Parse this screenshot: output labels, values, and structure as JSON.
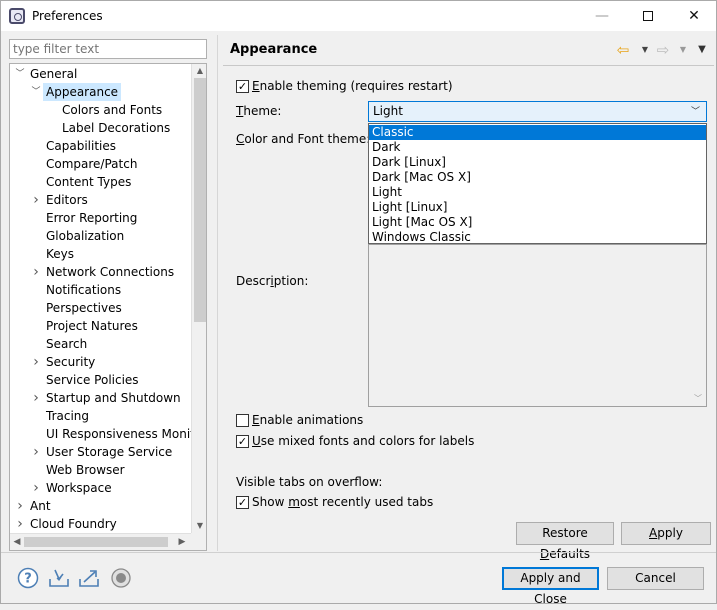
{
  "window": {
    "title": "Preferences",
    "controls": {
      "minimize": "—",
      "close": "✕"
    }
  },
  "filter": {
    "placeholder": "type filter text"
  },
  "tree": {
    "items": [
      {
        "label": "General",
        "level": 0,
        "toggle": "expanded"
      },
      {
        "label": "Appearance",
        "level": 1,
        "toggle": "expanded",
        "selected": true
      },
      {
        "label": "Colors and Fonts",
        "level": 2,
        "toggle": "none"
      },
      {
        "label": "Label Decorations",
        "level": 2,
        "toggle": "none"
      },
      {
        "label": "Capabilities",
        "level": 1,
        "toggle": "none"
      },
      {
        "label": "Compare/Patch",
        "level": 1,
        "toggle": "none"
      },
      {
        "label": "Content Types",
        "level": 1,
        "toggle": "none"
      },
      {
        "label": "Editors",
        "level": 1,
        "toggle": "collapsed"
      },
      {
        "label": "Error Reporting",
        "level": 1,
        "toggle": "none"
      },
      {
        "label": "Globalization",
        "level": 1,
        "toggle": "none"
      },
      {
        "label": "Keys",
        "level": 1,
        "toggle": "none"
      },
      {
        "label": "Network Connections",
        "level": 1,
        "toggle": "collapsed"
      },
      {
        "label": "Notifications",
        "level": 1,
        "toggle": "none"
      },
      {
        "label": "Perspectives",
        "level": 1,
        "toggle": "none"
      },
      {
        "label": "Project Natures",
        "level": 1,
        "toggle": "none"
      },
      {
        "label": "Search",
        "level": 1,
        "toggle": "none"
      },
      {
        "label": "Security",
        "level": 1,
        "toggle": "collapsed"
      },
      {
        "label": "Service Policies",
        "level": 1,
        "toggle": "none"
      },
      {
        "label": "Startup and Shutdown",
        "level": 1,
        "toggle": "collapsed"
      },
      {
        "label": "Tracing",
        "level": 1,
        "toggle": "none"
      },
      {
        "label": "UI Responsiveness Monitoring",
        "level": 1,
        "toggle": "none"
      },
      {
        "label": "User Storage Service",
        "level": 1,
        "toggle": "collapsed"
      },
      {
        "label": "Web Browser",
        "level": 1,
        "toggle": "none"
      },
      {
        "label": "Workspace",
        "level": 1,
        "toggle": "collapsed"
      },
      {
        "label": "Ant",
        "level": 0,
        "toggle": "collapsed"
      },
      {
        "label": "Cloud Foundry",
        "level": 0,
        "toggle": "collapsed"
      }
    ]
  },
  "page": {
    "title": "Appearance",
    "enable_theming": {
      "label_u": "E",
      "label_rest": "nable theming (requires restart)",
      "checked": true
    },
    "theme_label_u": "T",
    "theme_label_rest": "heme:",
    "theme_value": "Light",
    "color_font_label_u": "C",
    "color_font_label_rest": "olor and Font theme:",
    "theme_options": [
      "Classic",
      "Dark",
      "Dark [Linux]",
      "Dark [Mac OS X]",
      "Light",
      "Light [Linux]",
      "Light [Mac OS X]",
      "Windows Classic"
    ],
    "theme_options_selected": "Classic",
    "description_label_pre": "Descr",
    "description_label_u": "i",
    "description_label_post": "ption:",
    "enable_animations": {
      "label_u": "E",
      "label_rest": "nable animations",
      "checked": false
    },
    "mixed_fonts": {
      "label_u": "U",
      "label_rest": "se mixed fonts and colors for labels",
      "checked": true
    },
    "visible_tabs_label": "Visible tabs on overflow:",
    "show_mru": {
      "label_pre": "Show ",
      "label_u": "m",
      "label_rest": "ost recently used tabs",
      "checked": true
    },
    "restore_defaults_pre": "Restore ",
    "restore_defaults_u": "D",
    "restore_defaults_post": "efaults",
    "apply_u": "A",
    "apply_rest": "pply"
  },
  "footer": {
    "apply_close": "Apply and Close",
    "cancel": "Cancel"
  },
  "colors": {
    "accent": "#0078d7",
    "selection_tree": "#cce8ff"
  }
}
